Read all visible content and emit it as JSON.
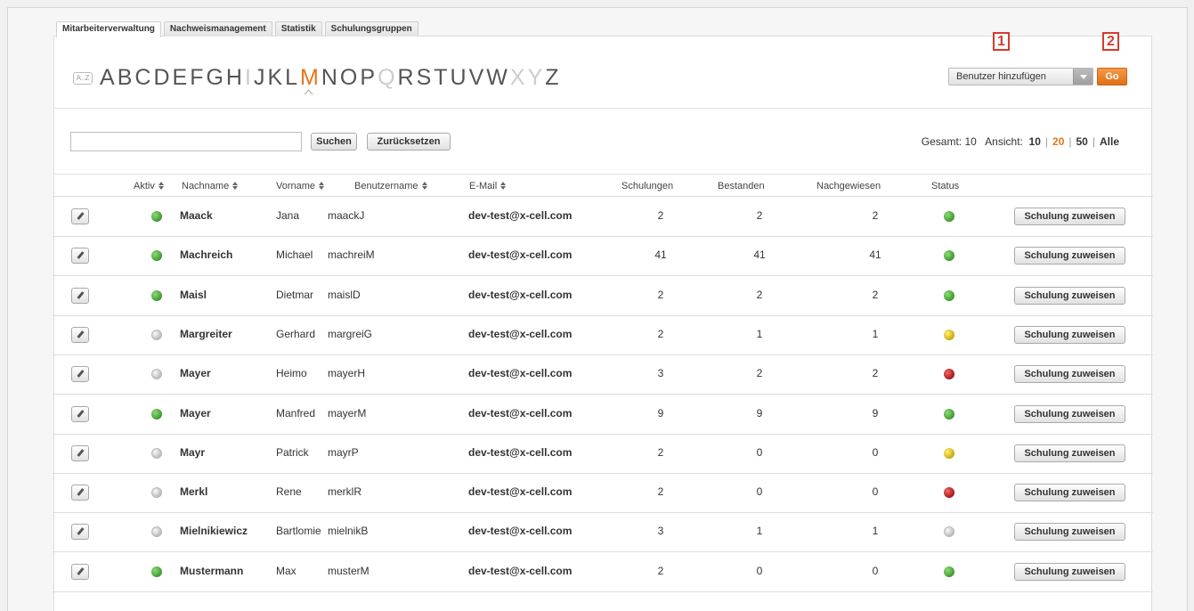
{
  "tabs": [
    "Mitarbeiterverwaltung",
    "Nachweismanagement",
    "Statistik",
    "Schulungsgruppen"
  ],
  "active_tab": 0,
  "az_icon_label": "A..Z",
  "letters": [
    {
      "l": "A",
      "state": "normal"
    },
    {
      "l": "B",
      "state": "normal"
    },
    {
      "l": "C",
      "state": "normal"
    },
    {
      "l": "D",
      "state": "normal"
    },
    {
      "l": "E",
      "state": "normal"
    },
    {
      "l": "F",
      "state": "normal"
    },
    {
      "l": "G",
      "state": "normal"
    },
    {
      "l": "H",
      "state": "normal"
    },
    {
      "l": "I",
      "state": "disabled"
    },
    {
      "l": "J",
      "state": "normal"
    },
    {
      "l": "K",
      "state": "normal"
    },
    {
      "l": "L",
      "state": "normal"
    },
    {
      "l": "M",
      "state": "active"
    },
    {
      "l": "N",
      "state": "normal"
    },
    {
      "l": "O",
      "state": "normal"
    },
    {
      "l": "P",
      "state": "normal"
    },
    {
      "l": "Q",
      "state": "disabled"
    },
    {
      "l": "R",
      "state": "normal"
    },
    {
      "l": "S",
      "state": "normal"
    },
    {
      "l": "T",
      "state": "normal"
    },
    {
      "l": "U",
      "state": "normal"
    },
    {
      "l": "V",
      "state": "normal"
    },
    {
      "l": "W",
      "state": "normal"
    },
    {
      "l": "X",
      "state": "disabled"
    },
    {
      "l": "Y",
      "state": "disabled"
    },
    {
      "l": "Z",
      "state": "normal"
    }
  ],
  "actions": {
    "select_label": "Benutzer hinzufügen",
    "go_label": "Go",
    "marker1": "1",
    "marker2": "2"
  },
  "search": {
    "value": "",
    "placeholder": "",
    "search_label": "Suchen",
    "reset_label": "Zurücksetzen"
  },
  "pager": {
    "total_label": "Gesamt:",
    "total": "10",
    "view_label": "Ansicht:",
    "options": [
      "10",
      "20",
      "50",
      "Alle"
    ],
    "current": "20"
  },
  "colors": {
    "accent": "#e8741a",
    "marker": "#d63a30"
  },
  "columns": [
    "Aktiv",
    "Nachname",
    "Vorname",
    "Benutzername",
    "E-Mail",
    "Schulungen",
    "Bestanden",
    "Nachgewiesen",
    "Status"
  ],
  "assign_label": "Schulung zuweisen",
  "rows": [
    {
      "active": "green",
      "last": "Maack",
      "first": "Jana",
      "user": "maackJ",
      "email": "dev-test@x-cell.com",
      "courses": "2",
      "passed": "2",
      "proven": "2",
      "status": "green"
    },
    {
      "active": "green",
      "last": "Machreich",
      "first": "Michael",
      "user": "machreiM",
      "email": "dev-test@x-cell.com",
      "courses": "41",
      "passed": "41",
      "proven": "41",
      "status": "green"
    },
    {
      "active": "green",
      "last": "Maisl",
      "first": "Dietmar",
      "user": "maislD",
      "email": "dev-test@x-cell.com",
      "courses": "2",
      "passed": "2",
      "proven": "2",
      "status": "green"
    },
    {
      "active": "grey",
      "last": "Margreiter",
      "first": "Gerhard",
      "user": "margreiG",
      "email": "dev-test@x-cell.com",
      "courses": "2",
      "passed": "1",
      "proven": "1",
      "status": "yellow"
    },
    {
      "active": "grey",
      "last": "Mayer",
      "first": "Heimo",
      "user": "mayerH",
      "email": "dev-test@x-cell.com",
      "courses": "3",
      "passed": "2",
      "proven": "2",
      "status": "red"
    },
    {
      "active": "green",
      "last": "Mayer",
      "first": "Manfred",
      "user": "mayerM",
      "email": "dev-test@x-cell.com",
      "courses": "9",
      "passed": "9",
      "proven": "9",
      "status": "green"
    },
    {
      "active": "grey",
      "last": "Mayr",
      "first": "Patrick",
      "user": "mayrP",
      "email": "dev-test@x-cell.com",
      "courses": "2",
      "passed": "0",
      "proven": "0",
      "status": "yellow"
    },
    {
      "active": "grey",
      "last": "Merkl",
      "first": "Rene",
      "user": "merklR",
      "email": "dev-test@x-cell.com",
      "courses": "2",
      "passed": "0",
      "proven": "0",
      "status": "red"
    },
    {
      "active": "grey",
      "last": "Mielnikiewicz",
      "first": "Bartlomie",
      "user": "mielnikB",
      "email": "dev-test@x-cell.com",
      "courses": "3",
      "passed": "1",
      "proven": "1",
      "status": "grey"
    },
    {
      "active": "green",
      "last": "Mustermann",
      "first": "Max",
      "user": "musterM",
      "email": "dev-test@x-cell.com",
      "courses": "2",
      "passed": "0",
      "proven": "0",
      "status": "green"
    }
  ]
}
